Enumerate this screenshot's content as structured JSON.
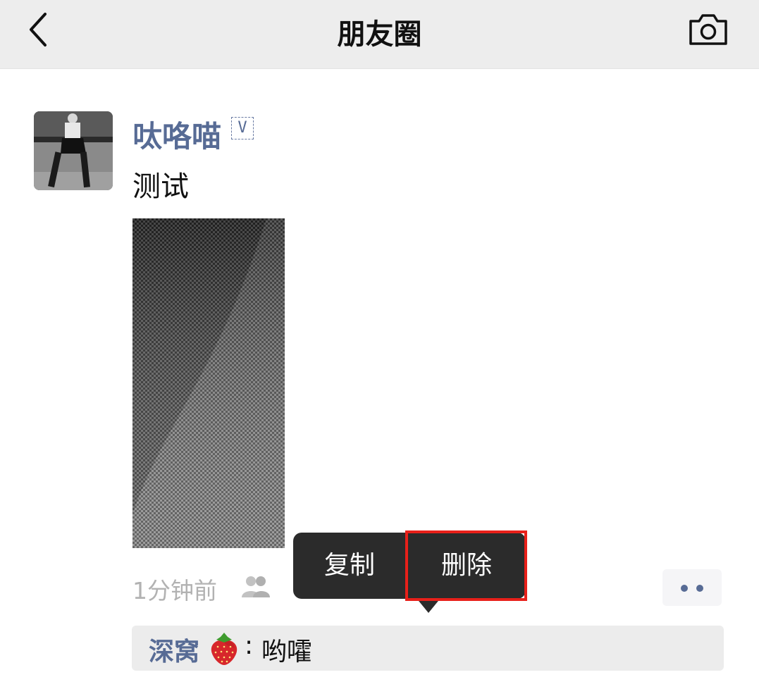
{
  "header": {
    "title": "朋友圈",
    "back_icon": "chevron-left-icon",
    "camera_icon": "camera-icon"
  },
  "post": {
    "username": "呔咯喵",
    "badge": "V",
    "text": "测试",
    "time": "1分钟前",
    "visibility_label": "",
    "more_icon": "more-dots-icon"
  },
  "context_menu": {
    "copy_label": "复制",
    "delete_label": "删除"
  },
  "comments": [
    {
      "author": "深窝",
      "emoji_icon": "strawberry-icon",
      "separator": ":",
      "text": "哟嚯"
    }
  ],
  "colors": {
    "link": "#576b95",
    "header_bg": "#ededed",
    "menu_bg": "#2b2b2b",
    "highlight": "#e8201a",
    "comment_bg": "#ececec"
  }
}
